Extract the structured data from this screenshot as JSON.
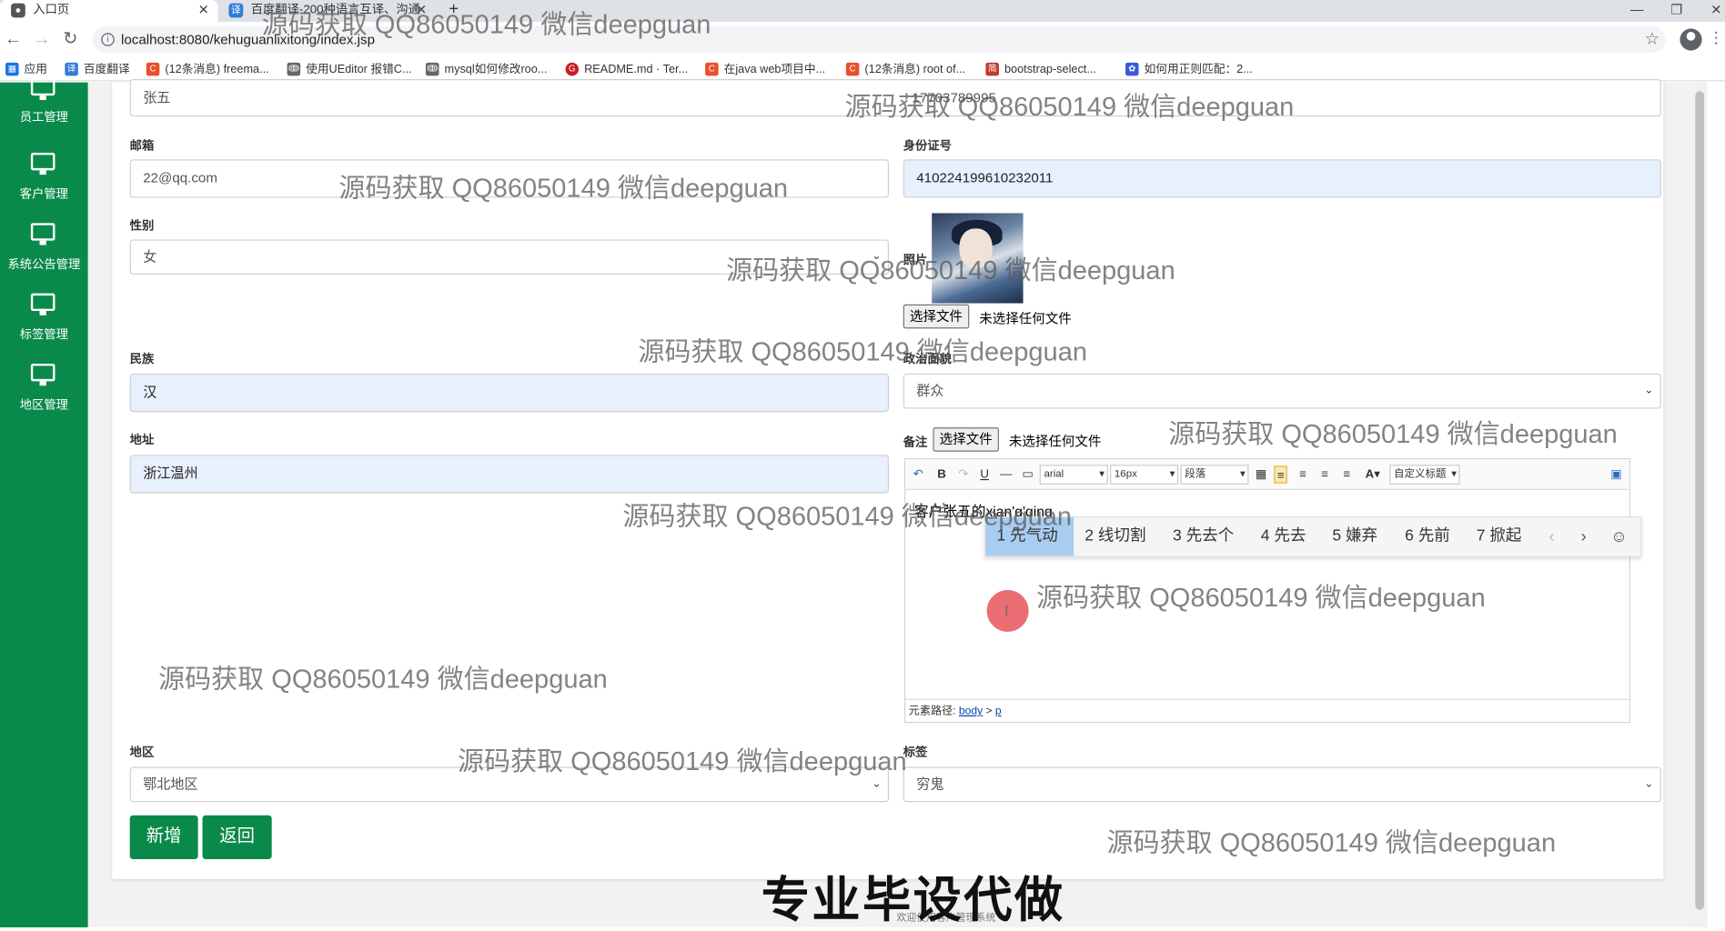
{
  "browser": {
    "tabs": [
      {
        "title": "入口页"
      },
      {
        "title": "百度翻译-200种语言互译、沟通"
      }
    ],
    "new_tab": "+",
    "url": "localhost:8080/kehuguanlixitong/index.jsp",
    "bookmarks": [
      "应用",
      "百度翻译",
      "(12条消息) freema...",
      "使用UEditor 报错C...",
      "mysql如何修改roo...",
      "README.md · Ter...",
      "在java web项目中...",
      "(12条消息) root of...",
      "bootstrap-select...",
      "如何用正则匹配：2..."
    ]
  },
  "sidebar": {
    "items": [
      "员工管理",
      "客户管理",
      "系统公告管理",
      "标签管理",
      "地区管理"
    ]
  },
  "form": {
    "top_values": [
      "张五",
      "17703789995"
    ],
    "email_label": "邮箱",
    "email_value": "22@qq.com",
    "idcard_label": "身份证号",
    "idcard_value": "410224199610232011",
    "gender_label": "性别",
    "gender_value": "女",
    "photo_label": "照片",
    "file_button": "选择文件",
    "file_none": "未选择任何文件",
    "nation_label": "民族",
    "nation_value": "汉",
    "political_label": "政治面貌",
    "political_value": "群众",
    "address_label": "地址",
    "address_value": "浙江温州",
    "remark_label": "备注",
    "region_label": "地区",
    "region_value": "鄂北地区",
    "tag_label": "标签",
    "tag_value": "穷鬼",
    "add_button": "新增",
    "back_button": "返回"
  },
  "editor": {
    "font": "arial",
    "size": "16px",
    "para": "段落",
    "custom": "自定义标题",
    "content": "客户张五的xian'q'qing",
    "path_label": "元素路径:",
    "path_body": "body",
    "path_sep": ">",
    "path_p": "p",
    "candidates": [
      "1 先气动",
      "2 线切割",
      "3 先去个",
      "4 先去",
      "5 嫌弃",
      "6 先前",
      "7 掀起"
    ]
  },
  "footer": "欢迎使用客户管理系统",
  "overlay": {
    "big": "专业毕设代做",
    "watermark": "源码获取 QQ86050149 微信deepguan"
  }
}
